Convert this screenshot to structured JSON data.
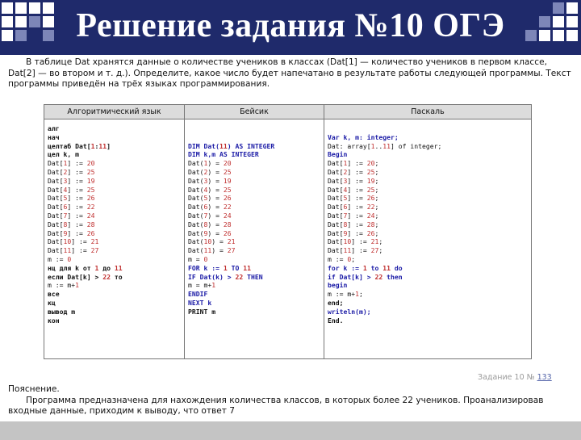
{
  "header": {
    "title": "Решение задания №10 ОГЭ",
    "background": "#1f2a6b"
  },
  "intro": {
    "line1": "В таблице Dat хранятся данные о количестве учеников в классах (Dat[1] — количество учеников в первом классе,",
    "line2": "Dat[2] — во втором и т. д.). Определите, какое число будет напечатано в результате работы следующей программы. Текст",
    "line3": "программы приведён на трёх языках программирования."
  },
  "table": {
    "headers": [
      "Алгоритмический язык",
      "Бейсик",
      "Паскаль"
    ]
  },
  "code": {
    "alg": [
      "алг",
      "нач",
      "целтаб Dat[1:11]",
      "цел k, m",
      "Dat[1] := 20",
      "Dat[2] := 25",
      "Dat[3] := 19",
      "Dat[4] := 25",
      "Dat[5] := 26",
      "Dat[6] := 22",
      "Dat[7] := 24",
      "Dat[8] := 28",
      "Dat[9] := 26",
      "Dat[10] := 21",
      "Dat[11] := 27",
      "m := 0",
      "нц для k от 1 до 11",
      "если Dat[k] > 22 то",
      "m := m+1",
      "все",
      "кц",
      "вывод m",
      "кон"
    ],
    "basic": [
      "DIM Dat(11) AS INTEGER",
      "DIM k,m AS INTEGER",
      "Dat(1) = 20",
      "Dat(2) = 25",
      "Dat(3) = 19",
      "Dat(4) = 25",
      "Dat(5) = 26",
      "Dat(6) = 22",
      "Dat(7) = 24",
      "Dat(8) = 28",
      "Dat(9) = 26",
      "Dat(10) = 21",
      "Dat(11) = 27",
      "m = 0",
      "FOR k := 1 TO 11",
      "IF Dat(k) > 22 THEN",
      "m = m+1",
      "ENDIF",
      "NEXT k",
      "PRINT m"
    ],
    "pascal": [
      "Var k, m: integer;",
      "Dat: array[1..11] of integer;",
      "Begin",
      "Dat[1] := 20;",
      "Dat[2] := 25;",
      "Dat[3] := 19;",
      "Dat[4] := 25;",
      "Dat[5] := 26;",
      "Dat[6] := 22;",
      "Dat[7] := 24;",
      "Dat[8] := 28;",
      "Dat[9] := 26;",
      "Dat[10] := 21;",
      "Dat[11] := 27;",
      "m := 0;",
      "for k := 1 to 11 do",
      "if Dat[k] > 22 then",
      "begin",
      "m := m+1;",
      "end;",
      "writeln(m);",
      "End."
    ]
  },
  "ghost": {
    "label": "Задание 10 №",
    "num": "133"
  },
  "answer": {
    "heading": "Пояснение.",
    "line1": "Программа предназначена для нахождения количества классов, в которых более 22 учеников. Проанализировав",
    "line2": "входные данные, приходим к выводу, что ответ 7"
  },
  "colors": {
    "accent": "#1f2a6b",
    "keyword": "#1a1aa6",
    "number": "#c03030",
    "footer": "#c4c4c4"
  }
}
